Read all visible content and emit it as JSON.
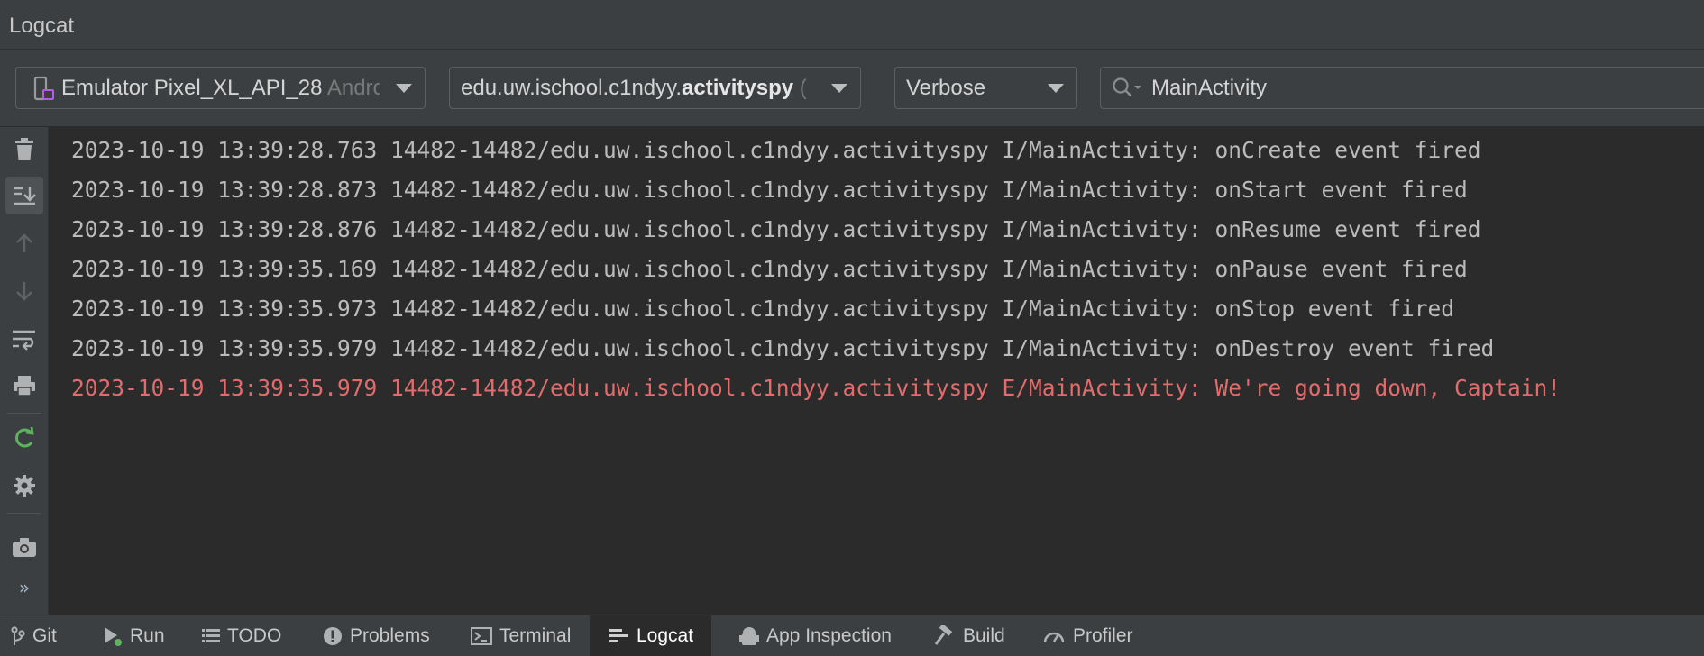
{
  "window": {
    "title": "Logcat"
  },
  "toolbar": {
    "device": {
      "name": "Emulator Pixel_XL_API_28",
      "suffix": "Andro"
    },
    "package": {
      "prefix": "edu.uw.ischool.c1ndyy.",
      "bold": "activityspy",
      "suffix": " ("
    },
    "level": "Verbose",
    "search": {
      "value": "MainActivity"
    }
  },
  "sidebar": {
    "icons": [
      "trash-icon",
      "scroll-to-end-icon",
      "arrow-up-icon",
      "arrow-down-icon",
      "soft-wrap-icon",
      "print-icon",
      "restart-icon",
      "gear-icon",
      "camera-icon",
      "more-icon"
    ],
    "more": "»"
  },
  "log": [
    {
      "text": "2023-10-19 13:39:28.763 14482-14482/edu.uw.ischool.c1ndyy.activityspy I/MainActivity: onCreate event fired",
      "level": "info"
    },
    {
      "text": "2023-10-19 13:39:28.873 14482-14482/edu.uw.ischool.c1ndyy.activityspy I/MainActivity: onStart event fired",
      "level": "info"
    },
    {
      "text": "2023-10-19 13:39:28.876 14482-14482/edu.uw.ischool.c1ndyy.activityspy I/MainActivity: onResume event fired",
      "level": "info"
    },
    {
      "text": "2023-10-19 13:39:35.169 14482-14482/edu.uw.ischool.c1ndyy.activityspy I/MainActivity: onPause event fired",
      "level": "info"
    },
    {
      "text": "2023-10-19 13:39:35.973 14482-14482/edu.uw.ischool.c1ndyy.activityspy I/MainActivity: onStop event fired",
      "level": "info"
    },
    {
      "text": "2023-10-19 13:39:35.979 14482-14482/edu.uw.ischool.c1ndyy.activityspy I/MainActivity: onDestroy event fired",
      "level": "info"
    },
    {
      "text": "2023-10-19 13:39:35.979 14482-14482/edu.uw.ischool.c1ndyy.activityspy E/MainActivity: We're going down, Captain!",
      "level": "error"
    }
  ],
  "colors": {
    "info": "#bbbbbb",
    "error": "#e06c6c",
    "background": "#2b2b2b",
    "panel": "#3c3f41"
  },
  "bottom_tabs": [
    {
      "label": "Git",
      "icon": "git-branch-icon"
    },
    {
      "label": "Run",
      "icon": "run-icon"
    },
    {
      "label": "TODO",
      "icon": "list-icon"
    },
    {
      "label": "Problems",
      "icon": "problems-icon"
    },
    {
      "label": "Terminal",
      "icon": "terminal-icon"
    },
    {
      "label": "Logcat",
      "icon": "logcat-icon",
      "active": true
    },
    {
      "label": "App Inspection",
      "icon": "app-inspection-icon"
    },
    {
      "label": "Build",
      "icon": "hammer-icon"
    },
    {
      "label": "Profiler",
      "icon": "gauge-icon"
    }
  ]
}
